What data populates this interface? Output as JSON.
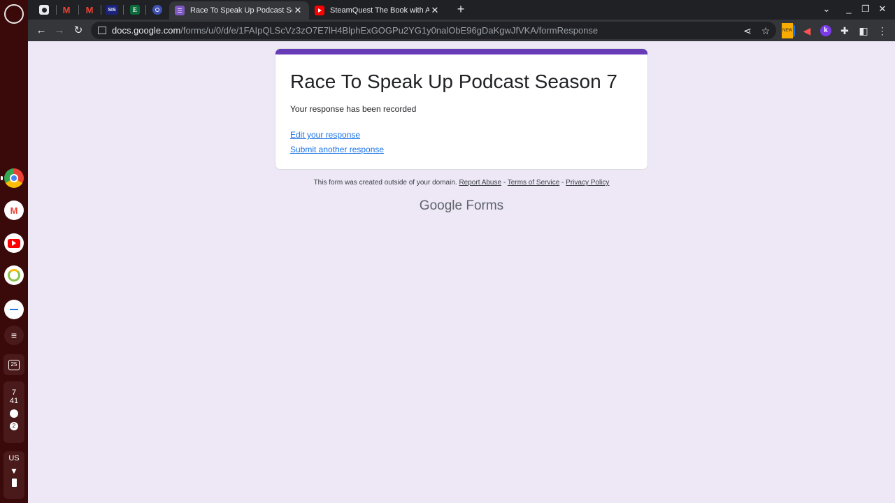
{
  "browser": {
    "tabs": [
      {
        "title": "Race To Speak Up Podcast Seas",
        "active": true
      },
      {
        "title": "SteamQuest The Book with Ahm",
        "active": false
      }
    ],
    "pinned_icons": [
      "contacts-icon",
      "gmail-icon",
      "gmail-icon",
      "sis-icon",
      "e-icon",
      "clock-icon"
    ],
    "pinned_sis_label": "SIS",
    "pinned_e_label": "E",
    "url_host": "docs.google.com",
    "url_path": "/forms/u/0/d/e/1FAIpQLScVz3zO7E7lH4BlphExGOGPu2YG1y0nalObE96gDaKgwJfVKA/formResponse",
    "new_badge": "NEW",
    "ext_k_label": "k"
  },
  "form": {
    "title": "Race To Speak Up Podcast Season 7",
    "message": "Your response has been recorded",
    "edit_link": "Edit your response",
    "submit_another_link": "Submit another response",
    "accent_color": "#673ab7"
  },
  "footer": {
    "note": "This form was created outside of your domain.",
    "report_abuse": "Report Abuse",
    "terms": "Terms of Service",
    "privacy": "Privacy Policy",
    "dash": "-",
    "brand_google": "Google",
    "brand_forms": "Forms"
  },
  "shelf": {
    "calendar_day": "25",
    "time_hour": "7",
    "time_min": "41",
    "notification_count": "2",
    "keyboard_layout": "US"
  }
}
